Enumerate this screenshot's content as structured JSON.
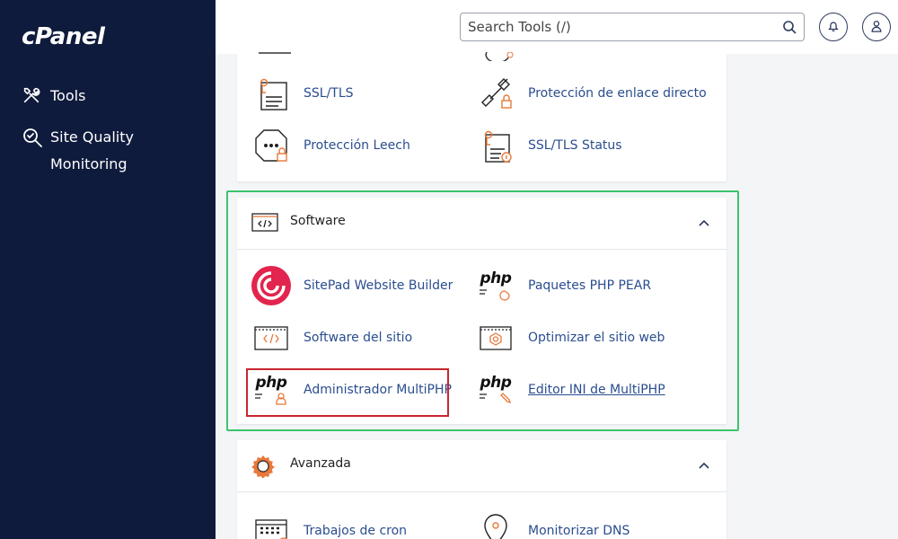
{
  "sidebar": {
    "logo": "cPanel",
    "items": [
      {
        "label": "Tools",
        "icon": "tools-icon"
      },
      {
        "label": "Site Quality Monitoring",
        "icon": "magnifier-check-icon"
      }
    ]
  },
  "header": {
    "search_placeholder": "Search Tools (/)",
    "icons": [
      "search-icon",
      "bell-icon",
      "user-icon"
    ]
  },
  "security_section": {
    "tools": [
      {
        "label": "SSL/TLS",
        "icon": "certificate-icon"
      },
      {
        "label": "Protección de enlace directo",
        "icon": "chain-lock-icon"
      },
      {
        "label": "Protección Leech",
        "icon": "octagon-lock-icon"
      },
      {
        "label": "SSL/TLS Status",
        "icon": "certificate-status-icon"
      }
    ]
  },
  "software_section": {
    "title": "Software",
    "tools": [
      {
        "label": "SitePad Website Builder",
        "icon": "sitepad-logo-icon"
      },
      {
        "label": "Paquetes PHP PEAR",
        "icon": "php-pear-icon",
        "glyph": "php"
      },
      {
        "label": "Software del sitio",
        "icon": "code-window-icon"
      },
      {
        "label": "Optimizar el sitio web",
        "icon": "optimize-icon"
      },
      {
        "label": "Administrador MultiPHP",
        "icon": "php-manager-icon",
        "glyph": "php"
      },
      {
        "label": "Editor INI de MultiPHP",
        "icon": "php-ini-editor-icon",
        "glyph": "php"
      }
    ]
  },
  "advanced_section": {
    "title": "Avanzada",
    "tools": [
      {
        "label": "Trabajos de cron",
        "icon": "calendar-icon"
      },
      {
        "label": "Monitorizar DNS",
        "icon": "location-pin-icon"
      }
    ]
  },
  "colors": {
    "sidebar_bg": "#0f1b3d",
    "link": "#2a4d8f",
    "accent_orange": "#e8793a",
    "highlight_green": "#3cc46c",
    "highlight_red": "#c8262e"
  }
}
